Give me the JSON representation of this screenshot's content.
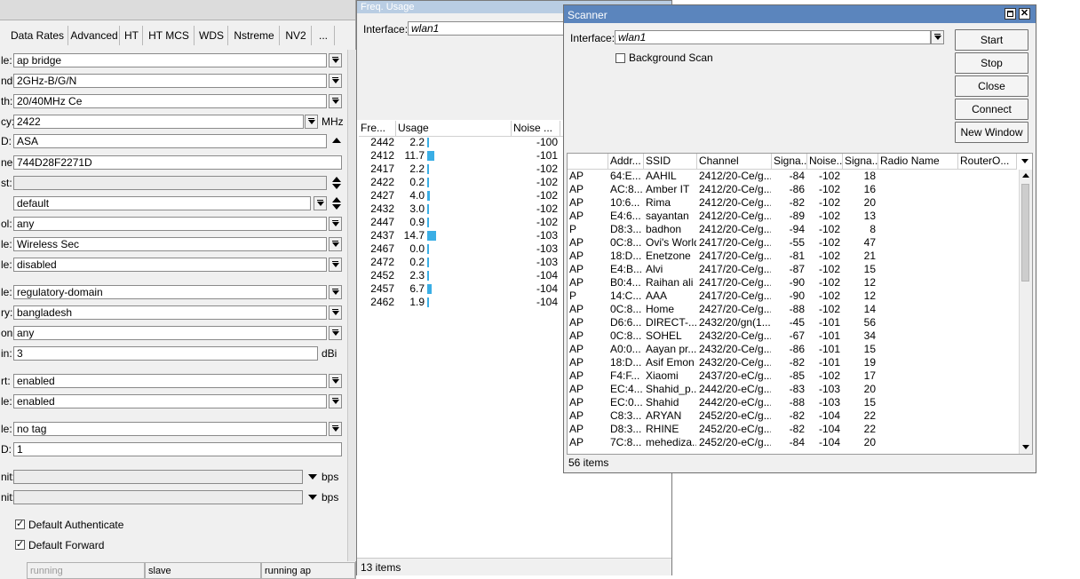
{
  "left_panel": {
    "tabs": [
      "Data Rates",
      "Advanced",
      "HT",
      "HT MCS",
      "WDS",
      "Nstreme",
      "NV2",
      "..."
    ],
    "fields": [
      {
        "label": "le:",
        "value": "ap bridge"
      },
      {
        "label": "nd:",
        "value": "2GHz-B/G/N"
      },
      {
        "label": "th:",
        "value": "20/40MHz Ce"
      },
      {
        "label": "cy:",
        "value": "2422",
        "unit": "MHz"
      },
      {
        "label": "D:",
        "value": "ASA"
      },
      {
        "label": "ne:",
        "value": "744D28F2271D"
      },
      {
        "label": "st:",
        "value": ""
      },
      {
        "label": "",
        "value": "default"
      },
      {
        "label": "ol:",
        "value": "any"
      },
      {
        "label": "le:",
        "value": "Wireless Sec"
      },
      {
        "label": "le:",
        "value": "disabled"
      },
      {
        "label": "le:",
        "value": "regulatory-domain"
      },
      {
        "label": "ry:",
        "value": "bangladesh"
      },
      {
        "label": "on:",
        "value": "any"
      },
      {
        "label": "in:",
        "value": "3",
        "unit": "dBi"
      },
      {
        "label": "rt:",
        "value": "enabled"
      },
      {
        "label": "le:",
        "value": "enabled"
      },
      {
        "label": "le:",
        "value": "no tag"
      },
      {
        "label": "D:",
        "value": "1"
      },
      {
        "label": "nit:",
        "value": "",
        "unit": "bps"
      },
      {
        "label": "nit:",
        "value": "",
        "unit": "bps"
      }
    ],
    "checkboxes": [
      {
        "label": "Default Authenticate",
        "checked": true
      },
      {
        "label": "Default Forward",
        "checked": true
      }
    ],
    "status": [
      "running",
      "slave",
      "running ap"
    ]
  },
  "freq_usage": {
    "title": "Freq. Usage",
    "interface_label": "Interface:",
    "interface_value": "wlan1",
    "columns": [
      "Fre...",
      "Usage",
      "Noise ..."
    ],
    "rows": [
      {
        "freq": "2442",
        "usage": "2.2",
        "noise": "-100"
      },
      {
        "freq": "2412",
        "usage": "11.7",
        "noise": "-101"
      },
      {
        "freq": "2417",
        "usage": "2.2",
        "noise": "-102"
      },
      {
        "freq": "2422",
        "usage": "0.2",
        "noise": "-102"
      },
      {
        "freq": "2427",
        "usage": "4.0",
        "noise": "-102"
      },
      {
        "freq": "2432",
        "usage": "3.0",
        "noise": "-102"
      },
      {
        "freq": "2447",
        "usage": "0.9",
        "noise": "-102"
      },
      {
        "freq": "2437",
        "usage": "14.7",
        "noise": "-103"
      },
      {
        "freq": "2467",
        "usage": "0.0",
        "noise": "-103"
      },
      {
        "freq": "2472",
        "usage": "0.2",
        "noise": "-103"
      },
      {
        "freq": "2452",
        "usage": "2.3",
        "noise": "-104"
      },
      {
        "freq": "2457",
        "usage": "6.7",
        "noise": "-104"
      },
      {
        "freq": "2462",
        "usage": "1.9",
        "noise": "-104"
      }
    ],
    "footer": "13 items",
    "bar_color": "#3aaee5"
  },
  "scanner": {
    "title": "Scanner",
    "interface_label": "Interface:",
    "interface_value": "wlan1",
    "background_scan_label": "Background Scan",
    "buttons": [
      "Start",
      "Stop",
      "Close",
      "Connect",
      "New Window"
    ],
    "columns": [
      "",
      "Addr...",
      "SSID",
      "Channel",
      "Signa...",
      "Noise...",
      "Signa...",
      "Radio Name",
      "RouterO..."
    ],
    "rows": [
      [
        "AP",
        "64:E...",
        "AAHIL",
        "2412/20-Ce/g...",
        "-84",
        "-102",
        "18"
      ],
      [
        "AP",
        "AC:8...",
        "Amber IT",
        "2412/20-Ce/g...",
        "-86",
        "-102",
        "16"
      ],
      [
        "AP",
        "10:6...",
        "Rima",
        "2412/20-Ce/g...",
        "-82",
        "-102",
        "20"
      ],
      [
        "AP",
        "E4:6...",
        "sayantan",
        "2412/20-Ce/g...",
        "-89",
        "-102",
        "13"
      ],
      [
        "P",
        "D8:3...",
        "badhon",
        "2412/20-Ce/g...",
        "-94",
        "-102",
        "8"
      ],
      [
        "AP",
        "0C:8...",
        "Ovi's World",
        "2417/20-Ce/g...",
        "-55",
        "-102",
        "47"
      ],
      [
        "AP",
        "18:D...",
        "Enetzone",
        "2417/20-Ce/g...",
        "-81",
        "-102",
        "21"
      ],
      [
        "AP",
        "E4:B...",
        "Alvi",
        "2417/20-Ce/g...",
        "-87",
        "-102",
        "15"
      ],
      [
        "AP",
        "B0:4...",
        "Raihan ali",
        "2417/20-Ce/g...",
        "-90",
        "-102",
        "12"
      ],
      [
        "P",
        "14:C...",
        "AAA",
        "2417/20-Ce/g...",
        "-90",
        "-102",
        "12"
      ],
      [
        "AP",
        "0C:8...",
        "Home",
        "2427/20-Ce/g...",
        "-88",
        "-102",
        "14"
      ],
      [
        "AP",
        "D6:6...",
        "DIRECT-...",
        "2432/20/gn(1...",
        "-45",
        "-101",
        "56"
      ],
      [
        "AP",
        "0C:8...",
        "SOHEL",
        "2432/20-Ce/g...",
        "-67",
        "-101",
        "34"
      ],
      [
        "AP",
        "A0:0...",
        "Aayan pr...",
        "2432/20-Ce/g...",
        "-86",
        "-101",
        "15"
      ],
      [
        "AP",
        "18:D...",
        "Asif Emon",
        "2432/20-Ce/g...",
        "-82",
        "-101",
        "19"
      ],
      [
        "AP",
        "F4:F...",
        "Xiaomi",
        "2437/20-eC/g...",
        "-85",
        "-102",
        "17"
      ],
      [
        "AP",
        "EC:4...",
        "Shahid_p...",
        "2442/20-eC/g...",
        "-83",
        "-103",
        "20"
      ],
      [
        "AP",
        "EC:0...",
        "Shahid",
        "2442/20-eC/g...",
        "-88",
        "-103",
        "15"
      ],
      [
        "AP",
        "C8:3...",
        "ARYAN",
        "2452/20-eC/g...",
        "-82",
        "-104",
        "22"
      ],
      [
        "AP",
        "D8:3...",
        "RHINE",
        "2452/20-eC/g...",
        "-82",
        "-104",
        "22"
      ],
      [
        "AP",
        "7C:8...",
        "mehediza...",
        "2452/20-eC/g...",
        "-84",
        "-104",
        "20"
      ]
    ],
    "footer": "56 items"
  }
}
